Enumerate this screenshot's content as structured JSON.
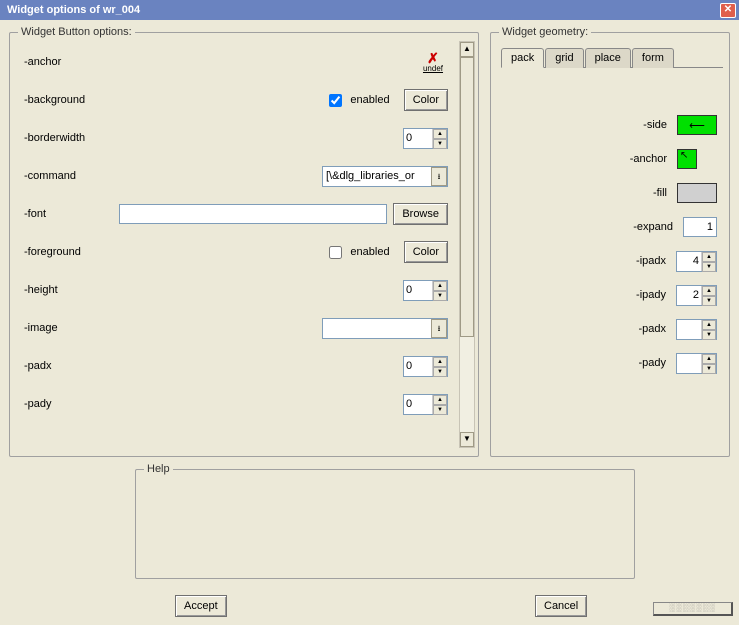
{
  "title": "Widget options of wr_004",
  "button_opts": {
    "legend": "Widget Button options:",
    "anchor": {
      "label": "-anchor",
      "undef": "undef"
    },
    "background": {
      "label": "-background",
      "enabled_label": "enabled",
      "enabled": true,
      "button": "Color"
    },
    "borderwidth": {
      "label": "-borderwidth",
      "value": "0"
    },
    "command": {
      "label": "-command",
      "value": "[\\&dlg_libraries_or"
    },
    "font": {
      "label": "-font",
      "value": "",
      "button": "Browse"
    },
    "foreground": {
      "label": "-foreground",
      "enabled_label": "enabled",
      "enabled": false,
      "button": "Color"
    },
    "height": {
      "label": "-height",
      "value": "0"
    },
    "image": {
      "label": "-image",
      "value": ""
    },
    "padx": {
      "label": "-padx",
      "value": "0"
    },
    "pady": {
      "label": "-pady",
      "value": "0"
    }
  },
  "geometry": {
    "legend": "Widget geometry:",
    "tabs": [
      "pack",
      "grid",
      "place",
      "form"
    ],
    "active_tab": "pack",
    "side": {
      "label": "-side"
    },
    "anchor": {
      "label": "-anchor"
    },
    "fill": {
      "label": "-fill"
    },
    "expand": {
      "label": "-expand",
      "value": "1"
    },
    "ipadx": {
      "label": "-ipadx",
      "value": "4"
    },
    "ipady": {
      "label": "-ipady",
      "value": "2"
    },
    "padx": {
      "label": "-padx",
      "value": ""
    },
    "pady": {
      "label": "-pady",
      "value": ""
    }
  },
  "help": {
    "legend": "Help"
  },
  "buttons": {
    "accept": "Accept",
    "cancel": "Cancel"
  }
}
